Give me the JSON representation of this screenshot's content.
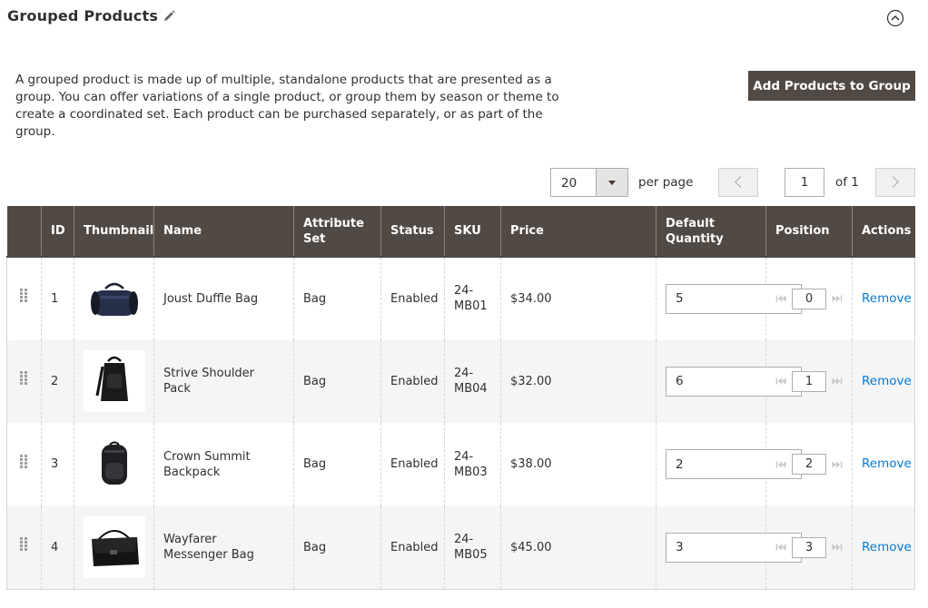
{
  "section": {
    "title": "Grouped Products",
    "description": "A grouped product is made up of multiple, standalone products that are presented as a group. You can offer variations of a single product, or group them by season or theme to create a coordinated set. Each product can be purchased separately, or as part of the group."
  },
  "toolbar": {
    "add_button_label": "Add Products to Group"
  },
  "pager": {
    "per_page_value": "20",
    "per_page_label": "per page",
    "current_page": "1",
    "of_label": "of 1"
  },
  "grid": {
    "columns": [
      "ID",
      "Thumbnail",
      "Name",
      "Attribute Set",
      "Status",
      "SKU",
      "Price",
      "Default Quantity",
      "Position",
      "Actions"
    ],
    "rows": [
      {
        "id": "1",
        "name": "Joust Duffle Bag",
        "attribute_set": "Bag",
        "status": "Enabled",
        "sku": "24-MB01",
        "price": "$34.00",
        "default_qty": "5",
        "position": "0",
        "action": "Remove",
        "thumb": "duffle-bag"
      },
      {
        "id": "2",
        "name": "Strive Shoulder Pack",
        "attribute_set": "Bag",
        "status": "Enabled",
        "sku": "24-MB04",
        "price": "$32.00",
        "default_qty": "6",
        "position": "1",
        "action": "Remove",
        "thumb": "shoulder-pack"
      },
      {
        "id": "3",
        "name": "Crown Summit Backpack",
        "attribute_set": "Bag",
        "status": "Enabled",
        "sku": "24-MB03",
        "price": "$38.00",
        "default_qty": "2",
        "position": "2",
        "action": "Remove",
        "thumb": "backpack"
      },
      {
        "id": "4",
        "name": "Wayfarer Messenger Bag",
        "attribute_set": "Bag",
        "status": "Enabled",
        "sku": "24-MB05",
        "price": "$45.00",
        "default_qty": "3",
        "position": "3",
        "action": "Remove",
        "thumb": "messenger-bag"
      }
    ]
  },
  "colors": {
    "header_bg": "#514943",
    "link": "#007bdb",
    "row_alt": "#f5f5f5"
  },
  "icons": [
    "pencil-icon",
    "collapse-circle-icon",
    "chevron-down-icon",
    "chevron-left-icon",
    "chevron-right-icon",
    "drag-handle-icon",
    "move-top-icon",
    "move-bottom-icon"
  ]
}
